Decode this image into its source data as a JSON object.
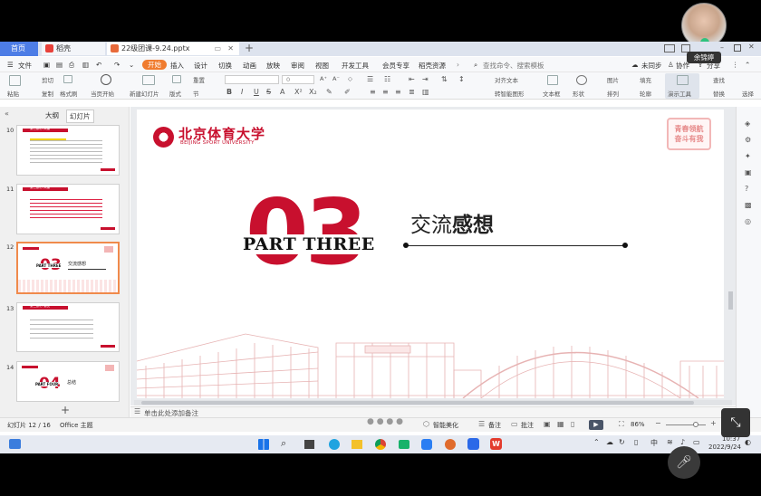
{
  "tabs": {
    "home": "首页",
    "docer": "稻壳",
    "file": "22级团课-9.24.pptx"
  },
  "menu": [
    "文件",
    "开始",
    "插入",
    "设计",
    "切换",
    "动画",
    "放映",
    "审阅",
    "视图",
    "开发工具",
    "会员专享",
    "稻壳资源"
  ],
  "search_placeholder": "查找命令、搜索模板",
  "top_right": {
    "sync": "未同步",
    "collab": "协作",
    "share": "分享"
  },
  "toolbar": {
    "paste": "粘贴",
    "cut": "剪切",
    "copy": "复制",
    "format_painter": "格式刷",
    "play_from_current": "当页开始",
    "new_slide": "新建幻灯片",
    "layout": "版式",
    "section": "节",
    "reset": "重置",
    "font_size": "0",
    "text_box": "文本框",
    "shape": "形状",
    "arrange": "排列",
    "image": "图片",
    "fill": "填充",
    "outline": "轮廓",
    "presenter_tools": "演示工具",
    "find": "查找",
    "replace": "替换",
    "select": "选择",
    "align_text": "对齐文本",
    "smartart": "转智能图形"
  },
  "panel_tabs": {
    "outline": "大纲",
    "slides": "幻灯片"
  },
  "thumbnails": [
    {
      "num": "10",
      "title": "第二部分·共建"
    },
    {
      "num": "11",
      "title": "第二部分·共建"
    },
    {
      "num": "12",
      "part": "PART THREE",
      "big": "03",
      "title": "交流感想"
    },
    {
      "num": "13",
      "title": "第二部分·感受"
    },
    {
      "num": "14",
      "part": "PART FOUR",
      "big": "04",
      "title": "总结"
    }
  ],
  "slide": {
    "logo_cn": "北京体育大学",
    "logo_en": "BEIJING SPORT UNIVERSITY",
    "big_number": "03",
    "part_label": "PART THREE",
    "heading_normal": "交流",
    "heading_bold": "感想",
    "stamp_line1": "青春领航",
    "stamp_line2": "奋斗有我"
  },
  "notes_placeholder": "单击此处添加备注",
  "status": {
    "slide_info": "幻灯片 12 / 16",
    "theme": "Office 主题",
    "beautify": "智能美化",
    "notes": "备注",
    "comments": "批注",
    "zoom": "86%"
  },
  "user_name": "余锦婷",
  "taskbar": {
    "lang": "中",
    "time": "10:37",
    "date": "2022/9/24"
  },
  "colors": {
    "accent_red": "#c8102e",
    "wps_orange": "#f07c2f",
    "home_blue": "#4d7de6"
  }
}
